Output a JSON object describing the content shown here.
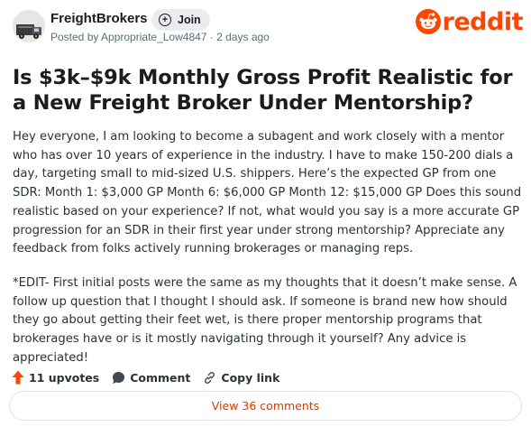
{
  "post": {
    "subreddit": "FreightBrokers",
    "join_label": "Join",
    "posted_by": "Posted by Appropriate_Low4847 · 2 days ago",
    "title": "Is $3k–$9k Monthly Gross Profit Realistic for a New Freight Broker Under Mentorship?",
    "body_paragraph_1": "Hey everyone, I am looking to become a subagent and work closely with a mentor who has over 10 years of experience in the industry. I have to make 150-200 dials a day, targeting small to mid-sized U.S. shippers. Here’s the expected GP from one SDR: Month 1: $3,000 GP Month 6: $6,000 GP Month 12: $15,000 GP Does this sound realistic based on your experience? If not, what would you say is a more accurate GP progression for an SDR in their first year under strong mentorship? Appreciate any feedback from folks actively running brokerages or managing reps.",
    "body_paragraph_2": "*EDIT- First initial posts were the same as my thoughts that it doesn’t make sense. A follow up question that I thought I should ask. If someone is brand new how should they go about getting their feet wet, is there proper mentorship programs that brokerages have or is it mostly navigating through it yourself? Any advice is appreciated!"
  },
  "brand": {
    "wordmark": "reddit",
    "color": "#ff4500"
  },
  "actions": {
    "upvotes_label": "11 upvotes",
    "comment_label": "Comment",
    "copy_link_label": "Copy link",
    "view_comments_label": "View 36 comments"
  },
  "icons": {
    "upvote": "upvote-arrow-icon",
    "comment": "comment-bubble-icon",
    "link": "link-icon",
    "join": "plus-circle-icon",
    "logo": "reddit-snoo-icon"
  }
}
